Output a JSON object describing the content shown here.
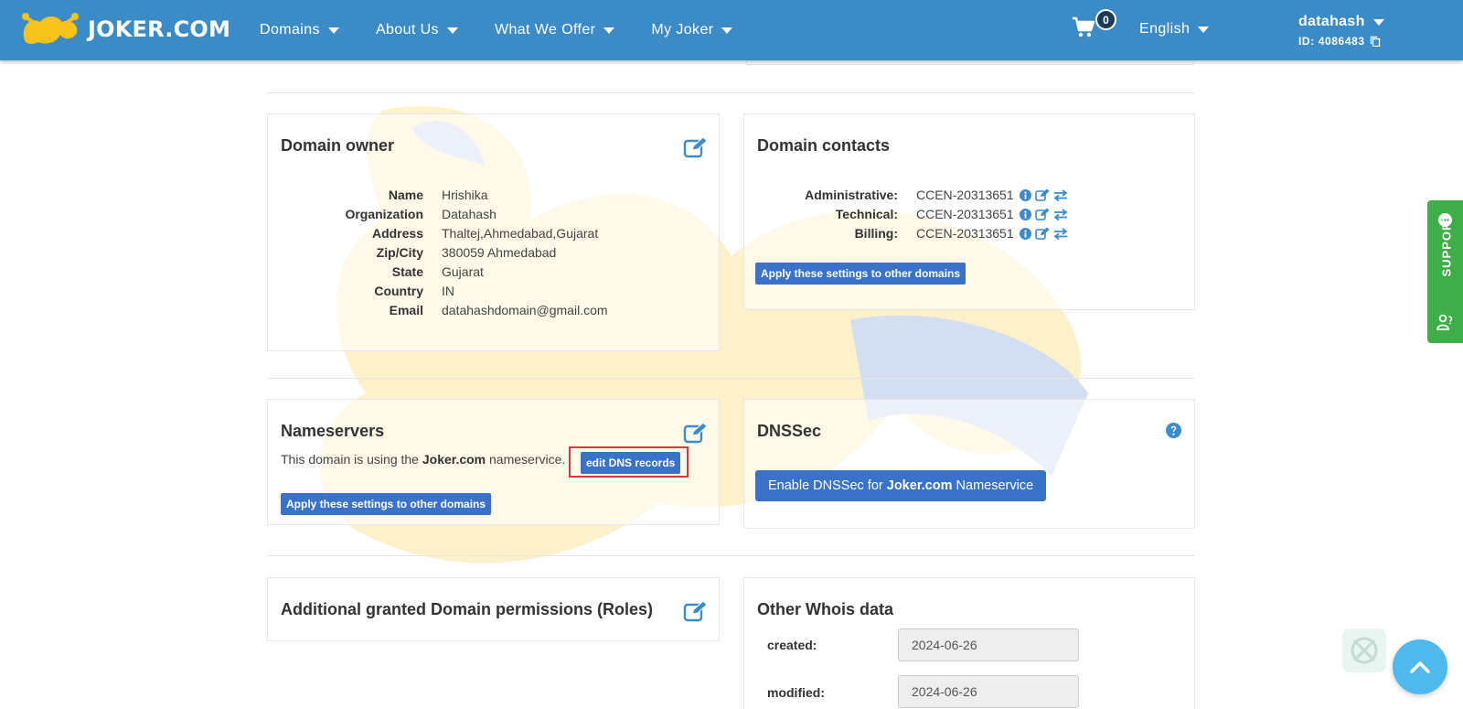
{
  "header": {
    "logo_text": "JOKER.COM",
    "nav": [
      {
        "label": "Domains"
      },
      {
        "label": "About Us"
      },
      {
        "label": "What We Offer"
      },
      {
        "label": "My Joker"
      }
    ],
    "cart_count": "0",
    "language": "English",
    "username": "datahash",
    "user_id": "ID: 4086483"
  },
  "domain_owner": {
    "title": "Domain owner",
    "fields": [
      {
        "label": "Name",
        "value": "Hrishika"
      },
      {
        "label": "Organization",
        "value": "Datahash"
      },
      {
        "label": "Address",
        "value": "Thaltej,Ahmedabad,Gujarat"
      },
      {
        "label": "Zip/City",
        "value": "380059 Ahmedabad"
      },
      {
        "label": "State",
        "value": "Gujarat"
      },
      {
        "label": "Country",
        "value": "IN"
      },
      {
        "label": "Email",
        "value": "datahashdomain@gmail.com"
      }
    ]
  },
  "domain_contacts": {
    "title": "Domain contacts",
    "rows": [
      {
        "label": "Administrative:",
        "value": "CCEN-20313651"
      },
      {
        "label": "Technical:",
        "value": "CCEN-20313651"
      },
      {
        "label": "Billing:",
        "value": "CCEN-20313651"
      }
    ],
    "apply_button": "Apply these settings to other domains"
  },
  "nameservers": {
    "title": "Nameservers",
    "text_prefix": "This domain is using the ",
    "text_bold": "Joker.com",
    "text_suffix": " nameservice.",
    "edit_dns_button": "edit DNS records",
    "apply_button": "Apply these settings to other domains"
  },
  "dnssec": {
    "title": "DNSSec",
    "button_prefix": "Enable DNSSec for ",
    "button_bold": "Joker.com",
    "button_suffix": " Nameservice"
  },
  "roles": {
    "title": "Additional granted Domain permissions (Roles)"
  },
  "whois": {
    "title": "Other Whois data",
    "created_label": "created:",
    "created_value": "2024-06-26",
    "modified_label": "modified:",
    "modified_value": "2024-06-26"
  },
  "support": {
    "label": "SUPPORT"
  },
  "colors": {
    "header": "#3b8cc6",
    "button": "#3a72c9",
    "support": "#3fae49",
    "scroll_top": "#4fb9ee",
    "highlight": "#d9363e"
  }
}
